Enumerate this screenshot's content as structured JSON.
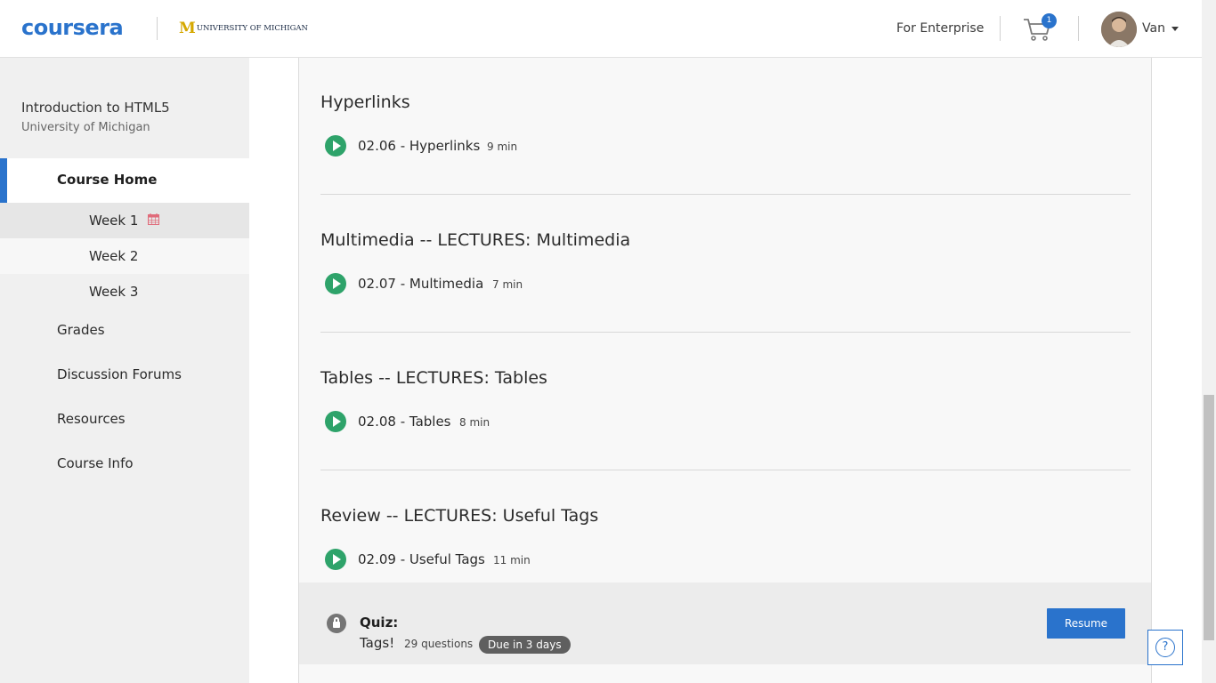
{
  "header": {
    "logo": "coursera",
    "partner_mark": "M",
    "partner_name": "UNIVERSITY OF MICHIGAN",
    "enterprise_link": "For Enterprise",
    "cart_icon": "shopping-cart-icon",
    "cart_count": "1",
    "username": "Van"
  },
  "sidebar": {
    "course_title": "Introduction to HTML5",
    "course_org": "University of Michigan",
    "home_label": "Course Home",
    "weeks": [
      {
        "label": "Week 1",
        "icon": "calendar-icon"
      },
      {
        "label": "Week 2"
      },
      {
        "label": "Week 3"
      }
    ],
    "items": [
      {
        "label": "Grades"
      },
      {
        "label": "Discussion Forums"
      },
      {
        "label": "Resources"
      },
      {
        "label": "Course Info"
      }
    ]
  },
  "main": {
    "sections": [
      {
        "title": "Hyperlinks",
        "lesson": "02.06 - Hyperlinks",
        "duration": "9 min"
      },
      {
        "title": "Multimedia -- LECTURES: Multimedia",
        "lesson": "02.07 - Multimedia",
        "duration": "7 min"
      },
      {
        "title": "Tables -- LECTURES: Tables",
        "lesson": "02.08 - Tables",
        "duration": "8 min"
      },
      {
        "title": "Review -- LECTURES: Useful Tags",
        "lesson": "02.09 - Useful Tags",
        "duration": "11 min"
      }
    ],
    "quiz": {
      "type": "Quiz:",
      "name": "Tags!",
      "questions": "29 questions",
      "due": "Due in 3 days",
      "button": "Resume"
    }
  },
  "help_label": "?",
  "colors": {
    "brand": "#2a73cc",
    "play": "#2ea36a",
    "michigan_maize": "#d5a800"
  }
}
